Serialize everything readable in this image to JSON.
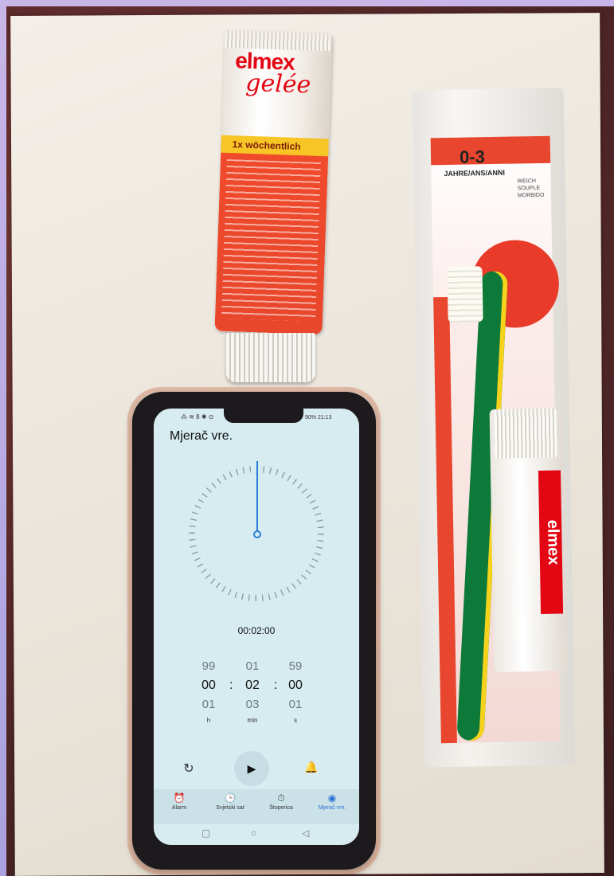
{
  "tube": {
    "brand": "elmex",
    "product": "gelée",
    "band": "1x wöchentlich"
  },
  "package": {
    "age": "0-3",
    "age_line": "JAHRE/ANS/ANNI",
    "softness": [
      "WEICH",
      "SOUPLE",
      "MORBIDO"
    ],
    "mini_brand": "elmex"
  },
  "phone": {
    "status_left": "⁂ ≋ 8 ✱ ⊙",
    "status_right": "90% 21:13",
    "app_title": "Mjerač vre.",
    "timer_readout": "00:02:00",
    "picker": {
      "hours": {
        "prev": "99",
        "sel": "00",
        "next": "01",
        "unit": "h"
      },
      "minutes": {
        "prev": "01",
        "sel": "02",
        "next": "03",
        "unit": "min"
      },
      "seconds": {
        "prev": "59",
        "sel": "00",
        "next": "01",
        "unit": "s"
      }
    },
    "separator": ":",
    "icons": {
      "reset": "↻",
      "play": "▶",
      "bell": "🔔"
    },
    "nav": [
      {
        "label": "Alarm",
        "icon": "⏰"
      },
      {
        "label": "Svjetski sat",
        "icon": "🕒"
      },
      {
        "label": "Štoperica",
        "icon": "⏱"
      },
      {
        "label": "Mjerač vre.",
        "icon": "◉"
      }
    ],
    "system_nav": {
      "recent": "▢",
      "home": "○",
      "back": "◁"
    }
  },
  "colors": {
    "accent": "#2a7bd8",
    "screen_bg": "#d7ecf1",
    "tube_red": "#e30613"
  }
}
